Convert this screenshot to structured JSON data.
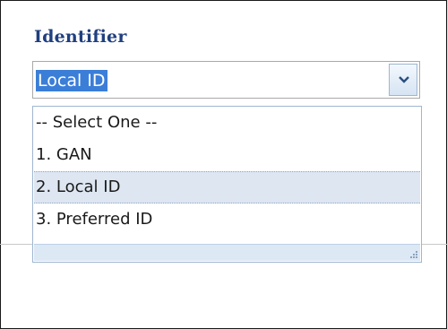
{
  "field": {
    "label": "Identifier"
  },
  "combo": {
    "value": "Local ID"
  },
  "options": [
    {
      "label": "-- Select One --"
    },
    {
      "label": "1. GAN"
    },
    {
      "label": "2. Local ID"
    },
    {
      "label": "3. Preferred ID"
    }
  ],
  "colors": {
    "label": "#1f3f7f",
    "selection": "#3b7ed8",
    "highlight_row": "#dde6f1"
  }
}
